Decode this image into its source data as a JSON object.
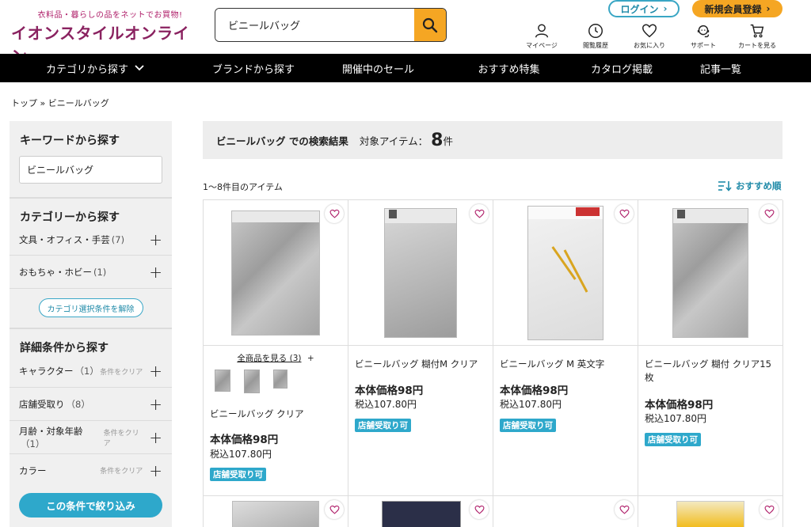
{
  "header": {
    "logo_tagline": "衣料品・暮らしの品をネットでお買物!",
    "logo_name": "イオンスタイルオンライン",
    "search_value": "ビニールバッグ",
    "login_label": "ログイン",
    "register_label": "新規会員登録",
    "icons": [
      {
        "name": "mypage-icon",
        "label": "マイページ"
      },
      {
        "name": "history-icon",
        "label": "閲覧履歴"
      },
      {
        "name": "favorite-icon",
        "label": "お気に入り"
      },
      {
        "name": "support-icon",
        "label": "サポート"
      },
      {
        "name": "cart-icon",
        "label": "カートを見る"
      }
    ]
  },
  "nav": {
    "items": [
      "カテゴリから探す",
      "ブランドから探す",
      "開催中のセール",
      "おすすめ特集",
      "カタログ掲載",
      "記事一覧"
    ]
  },
  "breadcrumb": {
    "top": "トップ",
    "sep": "»",
    "current": "ビニールバッグ"
  },
  "sidebar": {
    "keyword_title": "キーワードから探す",
    "keyword_value": "ビニールバッグ",
    "category_title": "カテゴリーから探す",
    "categories": [
      {
        "label": "文具・オフィス・手芸",
        "count": "(7)"
      },
      {
        "label": "おもちゃ・ホビー",
        "count": "(1)"
      }
    ],
    "clear_category_label": "カテゴリ選択条件を解除",
    "detail_title": "詳細条件から探す",
    "details": [
      {
        "label": "キャラクター",
        "count": "（1）",
        "clear": "条件をクリア"
      },
      {
        "label": "店舗受取り",
        "count": "（8）",
        "clear": ""
      },
      {
        "label": "月齢・対象年齢",
        "count": "（1）",
        "clear": "条件をクリア"
      },
      {
        "label": "カラー",
        "count": "",
        "clear": "条件をクリア"
      }
    ],
    "apply_label": "この条件で絞り込み"
  },
  "results": {
    "query": "ビニールバッグ での検索結果",
    "label": "対象アイテム：",
    "count": "8",
    "unit": "件",
    "range_text": "1〜8件目のアイテム",
    "sort_label": "おすすめ順"
  },
  "products": [
    {
      "see_all": "全商品を見る (3)",
      "see_all_plus": "+",
      "title": "ビニールバッグ クリア",
      "price": "本体価格98円",
      "tax_price": "税込107.80円",
      "badge": "店舗受取り可"
    },
    {
      "title": "ビニールバッグ 糊付M クリア",
      "price": "本体価格98円",
      "tax_price": "税込107.80円",
      "badge": "店舗受取り可"
    },
    {
      "title": "ビニールバッグ M 英文字",
      "price": "本体価格98円",
      "tax_price": "税込107.80円",
      "badge": "店舗受取り可"
    },
    {
      "title": "ビニールバッグ 糊付 クリア15",
      "title2": "枚",
      "price": "本体価格98円",
      "tax_price": "税込107.80円",
      "badge": "店舗受取り可"
    }
  ],
  "colors": {
    "accent_orange": "#f5a623",
    "accent_blue": "#2ea8cb",
    "brand": "#8a2260"
  }
}
